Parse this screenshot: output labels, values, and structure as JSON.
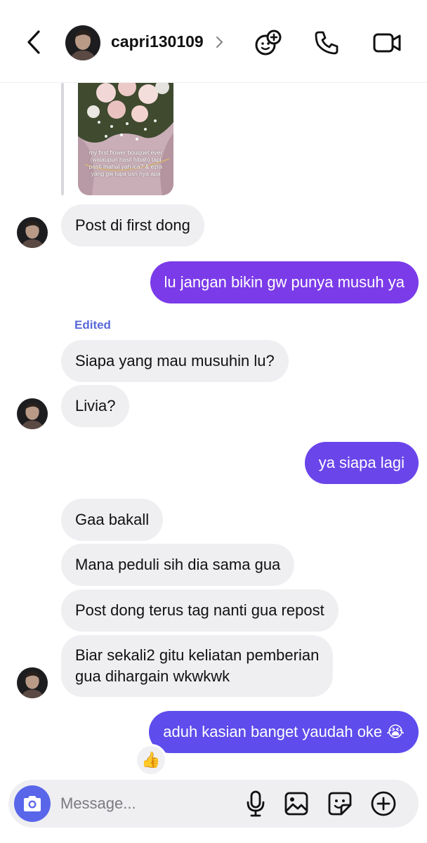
{
  "header": {
    "username": "capri130109",
    "icons": [
      "back-icon",
      "chevron-right-icon",
      "effects-icon",
      "phone-icon",
      "video-icon"
    ]
  },
  "shared_image": {
    "caption": "my first flower bouquet ever (walaupun hasil hibah) tapi pasti mahal yah ica? & ezra yang gw lupa usn nya apa"
  },
  "messages": [
    {
      "id": "m1",
      "direction": "received",
      "text": "Post di first dong"
    },
    {
      "id": "m2",
      "direction": "sent",
      "text": "lu jangan bikin gw punya musuh ya"
    },
    {
      "id": "m3",
      "direction": "received",
      "text": "Siapa yang mau musuhin lu?",
      "label": "Edited"
    },
    {
      "id": "m4",
      "direction": "received",
      "text": "Livia?"
    },
    {
      "id": "m5",
      "direction": "sent",
      "text": "ya siapa lagi"
    },
    {
      "id": "m6",
      "direction": "received",
      "text": "Gaa bakall"
    },
    {
      "id": "m7",
      "direction": "received",
      "text": "Mana peduli sih dia sama gua"
    },
    {
      "id": "m8",
      "direction": "received",
      "text": "Post dong terus tag nanti gua repost"
    },
    {
      "id": "m9",
      "direction": "received",
      "line1": "Biar sekali2 gitu keliatan pemberian",
      "line2": "gua dihargain wkwkwk"
    },
    {
      "id": "m10",
      "direction": "sent",
      "text": "aduh kasian banget yaudah oke 😭",
      "reaction": "👍"
    }
  ],
  "composer": {
    "placeholder": "Message...",
    "icons": [
      "camera-icon",
      "microphone-icon",
      "gallery-icon",
      "sticker-icon",
      "add-icon"
    ]
  },
  "colors": {
    "sent_bubble": "#7a3ee8",
    "received_bubble": "#efeff2",
    "camera_button": "#5966ea",
    "edited_label": "#5a68d8"
  }
}
